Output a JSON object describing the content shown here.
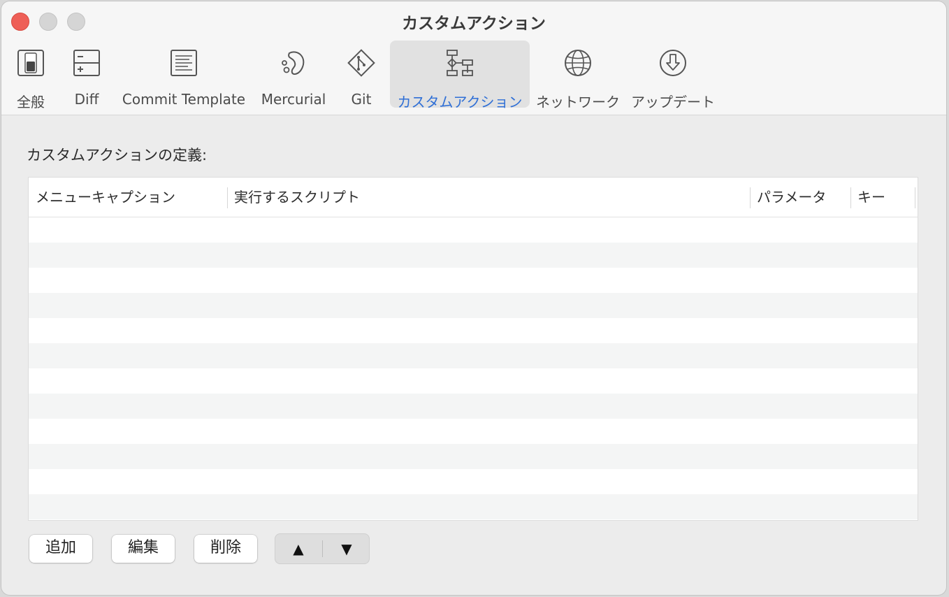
{
  "window": {
    "title": "カスタムアクション"
  },
  "toolbar": {
    "items": [
      {
        "label": "全般",
        "icon": "switch-icon"
      },
      {
        "label": "Diff",
        "icon": "diff-icon"
      },
      {
        "label": "Commit Template",
        "icon": "document-icon"
      },
      {
        "label": "Mercurial",
        "icon": "mercurial-icon"
      },
      {
        "label": "Git",
        "icon": "git-icon"
      },
      {
        "label": "カスタムアクション",
        "icon": "custom-action-icon",
        "selected": true
      },
      {
        "label": "ネットワーク",
        "icon": "globe-icon"
      },
      {
        "label": "アップデート",
        "icon": "download-icon"
      }
    ]
  },
  "section": {
    "label": "カスタムアクションの定義:"
  },
  "table": {
    "columns": [
      "メニューキャプション",
      "実行するスクリプト",
      "パラメータ",
      "キー"
    ],
    "rows": []
  },
  "buttons": {
    "add": "追加",
    "edit": "編集",
    "delete": "削除",
    "move_up": "▲",
    "move_down": "▼"
  },
  "colors": {
    "accent": "#2f6fd6",
    "close": "#ee5f57"
  }
}
